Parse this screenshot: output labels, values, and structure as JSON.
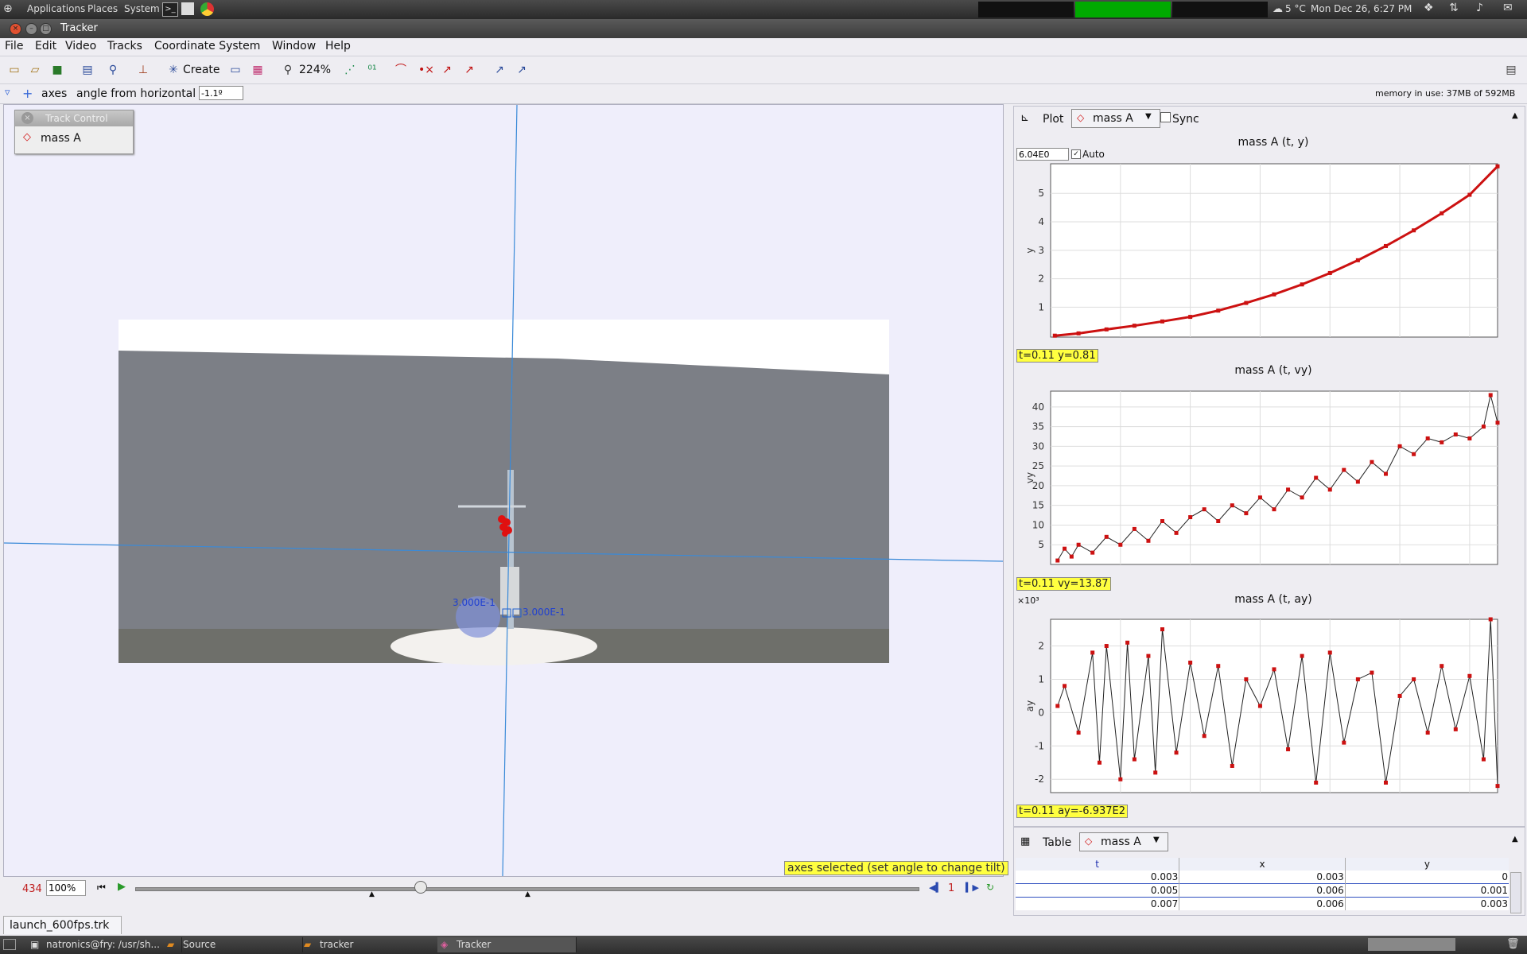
{
  "gnome_panel": {
    "menus": [
      "Applications",
      "Places",
      "System"
    ],
    "weather": "5 °C",
    "clock": "Mon Dec 26,  6:27 PM"
  },
  "window": {
    "title": "Tracker"
  },
  "menubar": [
    "File",
    "Edit",
    "Video",
    "Tracks",
    "Coordinate System",
    "Window",
    "Help"
  ],
  "toolbar": {
    "create_label": "Create",
    "zoom": "224%"
  },
  "axesbar": {
    "label": "axes",
    "angle_label": "angle from horizontal",
    "angle_value": "-1.1º",
    "memory": "memory in use: 37MB of 592MB"
  },
  "track_control": {
    "title": "Track Control",
    "track": "mass A"
  },
  "video": {
    "label_left": "3.000E-1",
    "label_right": "3.000E-1",
    "status": "axes selected (set angle to change tilt)",
    "frame_number": "434",
    "zoom": "100%",
    "step": "1",
    "file_tab": "launch_600fps.trk"
  },
  "plot_panel": {
    "label": "Plot",
    "track": "mass A",
    "sync": "Sync",
    "auto_value": "6.04E0",
    "auto_label": "Auto"
  },
  "chart_data": [
    {
      "type": "line",
      "title": "mass A (t, y)",
      "xlabel": "t",
      "ylabel": "y",
      "xlim": [
        0.0,
        0.32
      ],
      "ylim": [
        -0.05,
        6.04
      ],
      "xticks": [
        0.05,
        0.1,
        0.15,
        0.2,
        0.25,
        0.3
      ],
      "yticks": [
        1,
        2,
        3,
        4,
        5
      ],
      "x": [
        0.003,
        0.02,
        0.04,
        0.06,
        0.08,
        0.1,
        0.12,
        0.14,
        0.16,
        0.18,
        0.2,
        0.22,
        0.24,
        0.26,
        0.28,
        0.3,
        0.32
      ],
      "y": [
        0,
        0.08,
        0.22,
        0.35,
        0.5,
        0.66,
        0.88,
        1.15,
        1.45,
        1.8,
        2.2,
        2.65,
        3.15,
        3.7,
        4.3,
        4.95,
        5.95
      ],
      "readout": "t=0.11  y=0.81"
    },
    {
      "type": "line",
      "title": "mass A (t, vy)",
      "xlabel": "t",
      "ylabel": "vy",
      "xlim": [
        0.0,
        0.32
      ],
      "ylim": [
        0,
        44
      ],
      "xticks": [
        0.05,
        0.1,
        0.15,
        0.2,
        0.25,
        0.3
      ],
      "yticks": [
        5,
        10,
        15,
        20,
        25,
        30,
        35,
        40
      ],
      "x": [
        0.005,
        0.01,
        0.015,
        0.02,
        0.03,
        0.04,
        0.05,
        0.06,
        0.07,
        0.08,
        0.09,
        0.1,
        0.11,
        0.12,
        0.13,
        0.14,
        0.15,
        0.16,
        0.17,
        0.18,
        0.19,
        0.2,
        0.21,
        0.22,
        0.23,
        0.24,
        0.25,
        0.26,
        0.27,
        0.28,
        0.29,
        0.3,
        0.31,
        0.315,
        0.32
      ],
      "y": [
        1,
        4,
        2,
        5,
        3,
        7,
        5,
        9,
        6,
        11,
        8,
        12,
        14,
        11,
        15,
        13,
        17,
        14,
        19,
        17,
        22,
        19,
        24,
        21,
        26,
        23,
        30,
        28,
        32,
        31,
        33,
        32,
        35,
        43,
        36
      ],
      "readout": "t=0.11  vy=13.87"
    },
    {
      "type": "line",
      "title": "mass A (t, ay)",
      "xlabel": "t",
      "ylabel": "ay",
      "y_multiplier": "×10³",
      "xlim": [
        0.0,
        0.32
      ],
      "ylim": [
        -2.4,
        2.8
      ],
      "xticks": [
        0.05,
        0.1,
        0.15,
        0.2,
        0.25,
        0.3
      ],
      "yticks": [
        -2,
        -1,
        0,
        1,
        2
      ],
      "x": [
        0.005,
        0.01,
        0.02,
        0.03,
        0.035,
        0.04,
        0.05,
        0.055,
        0.06,
        0.07,
        0.075,
        0.08,
        0.09,
        0.1,
        0.11,
        0.12,
        0.13,
        0.14,
        0.15,
        0.16,
        0.17,
        0.18,
        0.19,
        0.2,
        0.21,
        0.22,
        0.23,
        0.24,
        0.25,
        0.26,
        0.27,
        0.28,
        0.29,
        0.3,
        0.31,
        0.315,
        0.32
      ],
      "y": [
        0.2,
        0.8,
        -0.6,
        1.8,
        -1.5,
        2.0,
        -2.0,
        2.1,
        -1.4,
        1.7,
        -1.8,
        2.5,
        -1.2,
        1.5,
        -0.7,
        1.4,
        -1.6,
        1.0,
        0.2,
        1.3,
        -1.1,
        1.7,
        -2.1,
        1.8,
        -0.9,
        1.0,
        1.2,
        -2.1,
        0.5,
        1.0,
        -0.6,
        1.4,
        -0.5,
        1.1,
        -1.4,
        2.8,
        -2.2
      ],
      "readout": "t=0.11  ay=-6.937E2"
    }
  ],
  "table_panel": {
    "label": "Table",
    "track": "mass A",
    "columns": [
      "t",
      "x",
      "y"
    ],
    "rows": [
      [
        "0.003",
        "0.003",
        "0"
      ],
      [
        "0.005",
        "0.006",
        "0.001"
      ],
      [
        "0.007",
        "0.006",
        "0.003"
      ]
    ]
  },
  "taskbar": [
    {
      "label": "natronics@fry: /usr/sh...",
      "icon": "terminal-icon"
    },
    {
      "label": "Source",
      "icon": "folder-icon"
    },
    {
      "label": "tracker",
      "icon": "folder-icon"
    },
    {
      "label": "Tracker",
      "icon": "tracker-app-icon"
    }
  ],
  "colors": {
    "track": "#cc1111",
    "axes": "#3a8ad8",
    "highlight": "#ffff40"
  }
}
